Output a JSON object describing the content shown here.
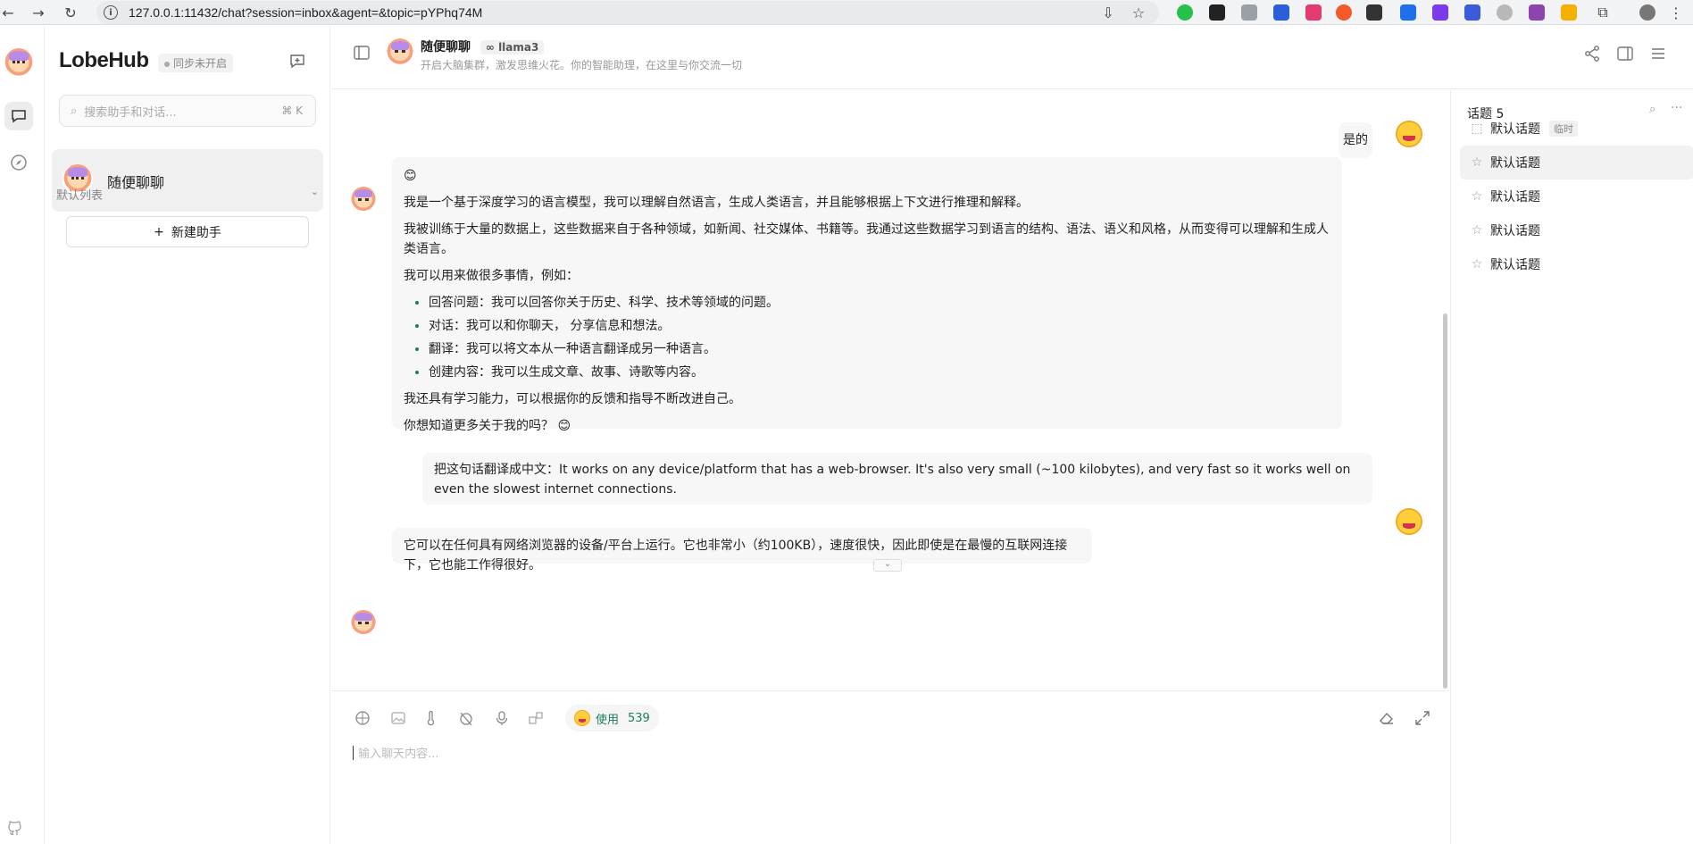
{
  "browser": {
    "url": "127.0.0.1:11432/chat?session=inbox&agent=&topic=pYPhq74M"
  },
  "sidebar": {
    "logo": "LobeHub",
    "sync_status": "同步未开启",
    "search_placeholder": "搜索助手和对话...",
    "search_shortcut": "⌘ K",
    "active_session": "随便聊聊",
    "group_label": "默认列表",
    "new_assistant": "新建助手"
  },
  "header": {
    "title": "随便聊聊",
    "model": "llama3",
    "description": "开启大脑集群，激发思维火花。你的智能助理，在这里与你交流一切"
  },
  "messages": {
    "user1": "是的",
    "assistant1": {
      "emoji": "😊",
      "p1": "我是一个基于深度学习的语言模型，我可以理解自然语言，生成人类语言，并且能够根据上下文进行推理和解释。",
      "p2": "我被训练于大量的数据上，这些数据来自于各种领域，如新闻、社交媒体、书籍等。我通过这些数据学习到语言的结构、语法、语义和风格，从而变得可以理解和生成人类语言。",
      "p3": "我可以用来做很多事情，例如：",
      "list": [
        "回答问题：我可以回答你关于历史、科学、技术等领域的问题。",
        "对话：我可以和你聊天， 分享信息和想法。",
        "翻译：我可以将文本从一种语言翻译成另一种语言。",
        "创建内容：我可以生成文章、故事、诗歌等内容。"
      ],
      "p4": "我还具有学习能力，可以根据你的反馈和指导不断改进自己。",
      "p5": "你想知道更多关于我的吗？ 😊"
    },
    "user2": "把这句话翻译成中文：It works on any device/platform that has a web-browser. It's also very small (~100 kilobytes), and very fast so it works well on even the slowest internet connections.",
    "assistant2": "它可以在任何具有网络浏览器的设备/平台上运行。它也非常小（约100KB），速度很快，因此即使是在最慢的互联网连接下，它也能工作得很好。"
  },
  "topics": {
    "title": "话题 5",
    "items": [
      {
        "label": "默认话题",
        "badge": "临时"
      },
      {
        "label": "默认话题"
      },
      {
        "label": "默认话题"
      },
      {
        "label": "默认话题"
      },
      {
        "label": "默认话题"
      }
    ]
  },
  "input": {
    "token_label": "使用",
    "token_count": "539",
    "placeholder": "输入聊天内容..."
  },
  "colors": {
    "accent_green": "#1a7f5a",
    "sidebar_active_bg": "#f0f0f0"
  }
}
